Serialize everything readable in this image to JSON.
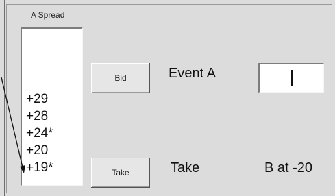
{
  "spread_list": {
    "title": "A Spread",
    "items": [
      "+29",
      "+28",
      "+24*",
      "+20",
      "+19*"
    ]
  },
  "buttons": {
    "bid": "Bid",
    "take": "Take"
  },
  "labels": {
    "event": "Event A",
    "take": "Take",
    "b_at": "B at -20"
  },
  "input": {
    "value": ""
  },
  "colors": {
    "background": "#dcdcdc",
    "list_background": "#ffffff",
    "button_face": "#e6e6e6"
  }
}
